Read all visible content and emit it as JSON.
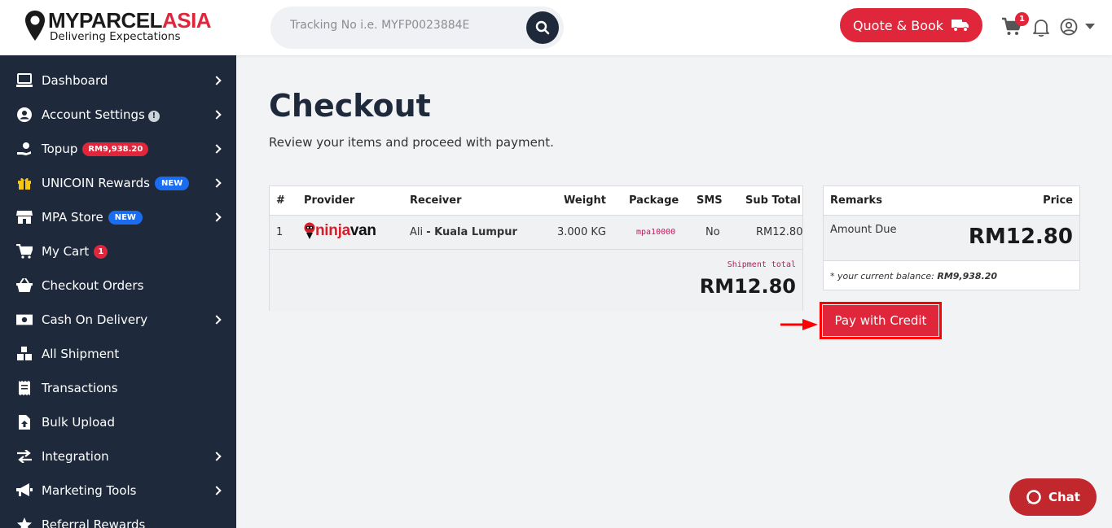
{
  "brand": {
    "name_part1": "MYPARCEL",
    "name_part2": "ASIA",
    "tagline": "Delivering Expectations",
    "primary_color": "#e0263b",
    "dark_color": "#1e2a3b"
  },
  "header": {
    "search_placeholder": "Tracking No i.e. MYFP0023884E",
    "quote_label": "Quote & Book",
    "cart_count": "1"
  },
  "sidebar": {
    "items": [
      {
        "label": "Dashboard",
        "icon": "laptop-icon"
      },
      {
        "label": "Account Settings",
        "icon": "user-circle-icon"
      },
      {
        "label": "Topup",
        "icon": "hand-coin-icon",
        "badge": "RM9,938.20"
      },
      {
        "label": "UNICOIN Rewards",
        "icon": "gift-icon",
        "badge": "NEW"
      },
      {
        "label": "MPA Store",
        "icon": "store-icon",
        "badge": "NEW"
      },
      {
        "label": "My Cart",
        "icon": "cart-icon",
        "badge": "1"
      },
      {
        "label": "Checkout Orders",
        "icon": "basket-icon"
      },
      {
        "label": "Cash On Delivery",
        "icon": "money-icon"
      },
      {
        "label": "All Shipment",
        "icon": "boxes-icon"
      },
      {
        "label": "Transactions",
        "icon": "receipt-icon"
      },
      {
        "label": "Bulk Upload",
        "icon": "file-upload-icon"
      },
      {
        "label": "Integration",
        "icon": "arrows-icon"
      },
      {
        "label": "Marketing Tools",
        "icon": "megaphone-icon"
      },
      {
        "label": "Referral Rewards",
        "icon": "star-icon"
      }
    ]
  },
  "main": {
    "title": "Checkout",
    "subtitle": "Review your items and proceed with payment.",
    "table": {
      "headers": [
        "#",
        "Provider",
        "Receiver",
        "Weight",
        "Package",
        "SMS",
        "Sub Total"
      ],
      "row": {
        "index": "1",
        "provider_part1": "ninja",
        "provider_part2": "van",
        "receiver_name": "Ali",
        "receiver_location": "- Kuala Lumpur",
        "weight": "3.000 KG",
        "package": "mpa10000",
        "sms": "No",
        "subtotal": "RM12.80"
      },
      "shipment_total_label": "Shipment total",
      "shipment_total": "RM12.80"
    },
    "summary": {
      "remarks_header": "Remarks",
      "price_header": "Price",
      "amount_due_label": "Amount Due",
      "amount_due": "RM12.80",
      "balance_prefix": "* your current balance: ",
      "balance_value": "RM9,938.20"
    },
    "pay_button": "Pay with Credit"
  },
  "chat": {
    "label": "Chat"
  }
}
